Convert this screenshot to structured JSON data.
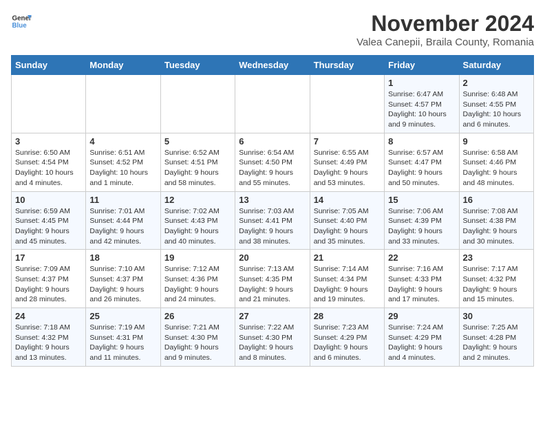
{
  "logo": {
    "line1": "General",
    "line2": "Blue"
  },
  "title": "November 2024",
  "subtitle": "Valea Canepii, Braila County, Romania",
  "days_of_week": [
    "Sunday",
    "Monday",
    "Tuesday",
    "Wednesday",
    "Thursday",
    "Friday",
    "Saturday"
  ],
  "weeks": [
    [
      {
        "day": "",
        "info": ""
      },
      {
        "day": "",
        "info": ""
      },
      {
        "day": "",
        "info": ""
      },
      {
        "day": "",
        "info": ""
      },
      {
        "day": "",
        "info": ""
      },
      {
        "day": "1",
        "info": "Sunrise: 6:47 AM\nSunset: 4:57 PM\nDaylight: 10 hours and 9 minutes."
      },
      {
        "day": "2",
        "info": "Sunrise: 6:48 AM\nSunset: 4:55 PM\nDaylight: 10 hours and 6 minutes."
      }
    ],
    [
      {
        "day": "3",
        "info": "Sunrise: 6:50 AM\nSunset: 4:54 PM\nDaylight: 10 hours and 4 minutes."
      },
      {
        "day": "4",
        "info": "Sunrise: 6:51 AM\nSunset: 4:52 PM\nDaylight: 10 hours and 1 minute."
      },
      {
        "day": "5",
        "info": "Sunrise: 6:52 AM\nSunset: 4:51 PM\nDaylight: 9 hours and 58 minutes."
      },
      {
        "day": "6",
        "info": "Sunrise: 6:54 AM\nSunset: 4:50 PM\nDaylight: 9 hours and 55 minutes."
      },
      {
        "day": "7",
        "info": "Sunrise: 6:55 AM\nSunset: 4:49 PM\nDaylight: 9 hours and 53 minutes."
      },
      {
        "day": "8",
        "info": "Sunrise: 6:57 AM\nSunset: 4:47 PM\nDaylight: 9 hours and 50 minutes."
      },
      {
        "day": "9",
        "info": "Sunrise: 6:58 AM\nSunset: 4:46 PM\nDaylight: 9 hours and 48 minutes."
      }
    ],
    [
      {
        "day": "10",
        "info": "Sunrise: 6:59 AM\nSunset: 4:45 PM\nDaylight: 9 hours and 45 minutes."
      },
      {
        "day": "11",
        "info": "Sunrise: 7:01 AM\nSunset: 4:44 PM\nDaylight: 9 hours and 42 minutes."
      },
      {
        "day": "12",
        "info": "Sunrise: 7:02 AM\nSunset: 4:43 PM\nDaylight: 9 hours and 40 minutes."
      },
      {
        "day": "13",
        "info": "Sunrise: 7:03 AM\nSunset: 4:41 PM\nDaylight: 9 hours and 38 minutes."
      },
      {
        "day": "14",
        "info": "Sunrise: 7:05 AM\nSunset: 4:40 PM\nDaylight: 9 hours and 35 minutes."
      },
      {
        "day": "15",
        "info": "Sunrise: 7:06 AM\nSunset: 4:39 PM\nDaylight: 9 hours and 33 minutes."
      },
      {
        "day": "16",
        "info": "Sunrise: 7:08 AM\nSunset: 4:38 PM\nDaylight: 9 hours and 30 minutes."
      }
    ],
    [
      {
        "day": "17",
        "info": "Sunrise: 7:09 AM\nSunset: 4:37 PM\nDaylight: 9 hours and 28 minutes."
      },
      {
        "day": "18",
        "info": "Sunrise: 7:10 AM\nSunset: 4:37 PM\nDaylight: 9 hours and 26 minutes."
      },
      {
        "day": "19",
        "info": "Sunrise: 7:12 AM\nSunset: 4:36 PM\nDaylight: 9 hours and 24 minutes."
      },
      {
        "day": "20",
        "info": "Sunrise: 7:13 AM\nSunset: 4:35 PM\nDaylight: 9 hours and 21 minutes."
      },
      {
        "day": "21",
        "info": "Sunrise: 7:14 AM\nSunset: 4:34 PM\nDaylight: 9 hours and 19 minutes."
      },
      {
        "day": "22",
        "info": "Sunrise: 7:16 AM\nSunset: 4:33 PM\nDaylight: 9 hours and 17 minutes."
      },
      {
        "day": "23",
        "info": "Sunrise: 7:17 AM\nSunset: 4:32 PM\nDaylight: 9 hours and 15 minutes."
      }
    ],
    [
      {
        "day": "24",
        "info": "Sunrise: 7:18 AM\nSunset: 4:32 PM\nDaylight: 9 hours and 13 minutes."
      },
      {
        "day": "25",
        "info": "Sunrise: 7:19 AM\nSunset: 4:31 PM\nDaylight: 9 hours and 11 minutes."
      },
      {
        "day": "26",
        "info": "Sunrise: 7:21 AM\nSunset: 4:30 PM\nDaylight: 9 hours and 9 minutes."
      },
      {
        "day": "27",
        "info": "Sunrise: 7:22 AM\nSunset: 4:30 PM\nDaylight: 9 hours and 8 minutes."
      },
      {
        "day": "28",
        "info": "Sunrise: 7:23 AM\nSunset: 4:29 PM\nDaylight: 9 hours and 6 minutes."
      },
      {
        "day": "29",
        "info": "Sunrise: 7:24 AM\nSunset: 4:29 PM\nDaylight: 9 hours and 4 minutes."
      },
      {
        "day": "30",
        "info": "Sunrise: 7:25 AM\nSunset: 4:28 PM\nDaylight: 9 hours and 2 minutes."
      }
    ]
  ]
}
